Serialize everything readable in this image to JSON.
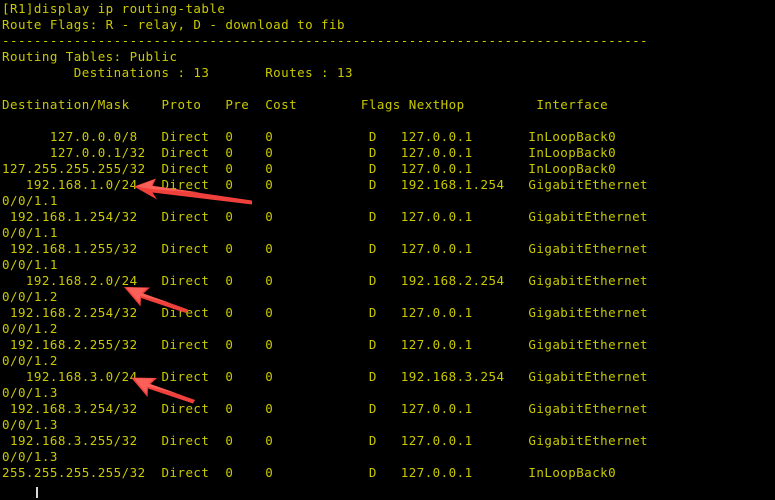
{
  "terminal": {
    "background_color": "#000000",
    "text_color": "#c9c900",
    "cursor_color": "#d8d8d8",
    "arrow_color": "#f0403c",
    "prompt_line": "[R1]display ip routing-table",
    "route_flags_line": "Route Flags: R - relay, D - download to fib",
    "separator": "---------------------------------------------------------------------------------",
    "routing_tables_line": "Routing Tables: Public",
    "summary_line": "         Destinations : 13       Routes : 13",
    "columns": {
      "destination_mask": "Destination/Mask",
      "proto": "Proto",
      "pre": "Pre",
      "cost": "Cost",
      "flags": "Flags",
      "nexthop": "NextHop",
      "interface": "Interface"
    },
    "header_line": "Destination/Mask    Proto   Pre  Cost        Flags NextHop         Interface",
    "destinations_count": "13",
    "routes_count": "13",
    "routes": [
      {
        "destination_mask": "127.0.0.0/8",
        "proto": "Direct",
        "pre": "0",
        "cost": "0",
        "flags": "D",
        "nexthop": "127.0.0.1",
        "interface": "InLoopBack0",
        "wrapped": false
      },
      {
        "destination_mask": "127.0.0.1/32",
        "proto": "Direct",
        "pre": "0",
        "cost": "0",
        "flags": "D",
        "nexthop": "127.0.0.1",
        "interface": "InLoopBack0",
        "wrapped": false
      },
      {
        "destination_mask": "127.255.255.255/32",
        "proto": "Direct",
        "pre": "0",
        "cost": "0",
        "flags": "D",
        "nexthop": "127.0.0.1",
        "interface": "InLoopBack0",
        "wrapped": false
      },
      {
        "destination_mask": "192.168.1.0/24",
        "proto": "Direct",
        "pre": "0",
        "cost": "0",
        "flags": "D",
        "nexthop": "192.168.1.254",
        "interface": "GigabitEthernet",
        "interface_wrap": "0/0/1.1",
        "wrapped": true
      },
      {
        "destination_mask": "192.168.1.254/32",
        "proto": "Direct",
        "pre": "0",
        "cost": "0",
        "flags": "D",
        "nexthop": "127.0.0.1",
        "interface": "GigabitEthernet",
        "interface_wrap": "0/0/1.1",
        "wrapped": true
      },
      {
        "destination_mask": "192.168.1.255/32",
        "proto": "Direct",
        "pre": "0",
        "cost": "0",
        "flags": "D",
        "nexthop": "127.0.0.1",
        "interface": "GigabitEthernet",
        "interface_wrap": "0/0/1.1",
        "wrapped": true
      },
      {
        "destination_mask": "192.168.2.0/24",
        "proto": "Direct",
        "pre": "0",
        "cost": "0",
        "flags": "D",
        "nexthop": "192.168.2.254",
        "interface": "GigabitEthernet",
        "interface_wrap": "0/0/1.2",
        "wrapped": true
      },
      {
        "destination_mask": "192.168.2.254/32",
        "proto": "Direct",
        "pre": "0",
        "cost": "0",
        "flags": "D",
        "nexthop": "127.0.0.1",
        "interface": "GigabitEthernet",
        "interface_wrap": "0/0/1.2",
        "wrapped": true
      },
      {
        "destination_mask": "192.168.2.255/32",
        "proto": "Direct",
        "pre": "0",
        "cost": "0",
        "flags": "D",
        "nexthop": "127.0.0.1",
        "interface": "GigabitEthernet",
        "interface_wrap": "0/0/1.2",
        "wrapped": true
      },
      {
        "destination_mask": "192.168.3.0/24",
        "proto": "Direct",
        "pre": "0",
        "cost": "0",
        "flags": "D",
        "nexthop": "192.168.3.254",
        "interface": "GigabitEthernet",
        "interface_wrap": "0/0/1.3",
        "wrapped": true
      },
      {
        "destination_mask": "192.168.3.254/32",
        "proto": "Direct",
        "pre": "0",
        "cost": "0",
        "flags": "D",
        "nexthop": "127.0.0.1",
        "interface": "GigabitEthernet",
        "interface_wrap": "0/0/1.3",
        "wrapped": true
      },
      {
        "destination_mask": "192.168.3.255/32",
        "proto": "Direct",
        "pre": "0",
        "cost": "0",
        "flags": "D",
        "nexthop": "127.0.0.1",
        "interface": "GigabitEthernet",
        "interface_wrap": "0/0/1.3",
        "wrapped": true
      },
      {
        "destination_mask": "255.255.255.255/32",
        "proto": "Direct",
        "pre": "0",
        "cost": "0",
        "flags": "D",
        "nexthop": "127.0.0.1",
        "interface": "InLoopBack0",
        "wrapped": false
      }
    ],
    "full_text": "[R1]display ip routing-table\nRoute Flags: R - relay, D - download to fib\n---------------------------------------------------------------------------------\nRouting Tables: Public\n         Destinations : 13       Routes : 13\n\nDestination/Mask    Proto   Pre  Cost        Flags NextHop         Interface\n\n      127.0.0.0/8   Direct  0    0            D   127.0.0.1       InLoopBack0\n      127.0.0.1/32  Direct  0    0            D   127.0.0.1       InLoopBack0\n127.255.255.255/32  Direct  0    0            D   127.0.0.1       InLoopBack0\n   192.168.1.0/24   Direct  0    0            D   192.168.1.254   GigabitEthernet\n0/0/1.1\n 192.168.1.254/32   Direct  0    0            D   127.0.0.1       GigabitEthernet\n0/0/1.1\n 192.168.1.255/32   Direct  0    0            D   127.0.0.1       GigabitEthernet\n0/0/1.1\n   192.168.2.0/24   Direct  0    0            D   192.168.2.254   GigabitEthernet\n0/0/1.2\n 192.168.2.254/32   Direct  0    0            D   127.0.0.1       GigabitEthernet\n0/0/1.2\n 192.168.2.255/32   Direct  0    0            D   127.0.0.1       GigabitEthernet\n0/0/1.2\n   192.168.3.0/24   Direct  0    0            D   192.168.3.254   GigabitEthernet\n0/0/1.3\n 192.168.3.254/32   Direct  0    0            D   127.0.0.1       GigabitEthernet\n0/0/1.3\n 192.168.3.255/32   Direct  0    0            D   127.0.0.1       GigabitEthernet\n0/0/1.3\n255.255.255.255/32  Direct  0    0            D   127.0.0.1       InLoopBack0"
  },
  "annotations": {
    "arrows": [
      {
        "label": "arrow-pointing-192-168-1-0-24",
        "target": "192.168.1.0/24"
      },
      {
        "label": "arrow-pointing-192-168-2-0-24",
        "target": "192.168.2.0/24"
      },
      {
        "label": "arrow-pointing-192-168-3-0-24",
        "target": "192.168.3.0/24"
      }
    ]
  }
}
